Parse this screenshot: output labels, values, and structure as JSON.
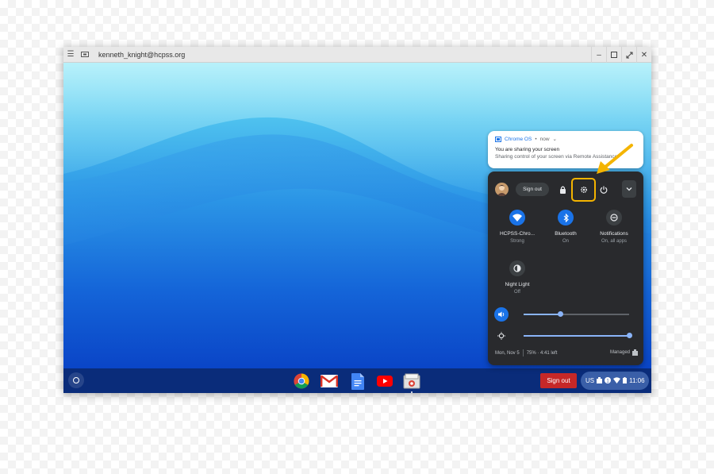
{
  "window": {
    "title": "kenneth_knight@hcpss.org",
    "controls": [
      "minimize",
      "maximize",
      "fullscreen",
      "close"
    ]
  },
  "notification": {
    "source": "Chrome OS",
    "time": "now",
    "title": "You are sharing your screen",
    "body": "Sharing control of your screen via Remote Assistance"
  },
  "quick_settings": {
    "sign_out_label": "Sign out",
    "features": [
      {
        "label": "HCPSS-Chro...",
        "sub": "Strong",
        "icon": "wifi-icon",
        "active": true
      },
      {
        "label": "Bluetooth",
        "sub": "On",
        "icon": "bluetooth-icon",
        "active": true
      },
      {
        "label": "Notifications",
        "sub": "On, all apps",
        "icon": "notifications-icon",
        "active": false
      },
      {
        "label": "Night Light",
        "sub": "Off",
        "icon": "night-light-icon",
        "active": false
      }
    ],
    "volume_level": 0.35,
    "brightness_level": 1.0,
    "date": "Mon, Nov 5",
    "battery": "75% · 4:41 left",
    "managed_label": "Managed"
  },
  "shelf": {
    "apps": [
      "chrome-icon",
      "gmail-icon",
      "docs-icon",
      "youtube-icon",
      "files-icon"
    ],
    "sign_out_label": "Sign out",
    "tray": {
      "locale": "US",
      "time": "11:06"
    }
  },
  "colors": {
    "accent": "#8ab4f8",
    "highlight": "#f4b400",
    "active_toggle": "#1a73e8",
    "sign_out_red": "#c62828"
  }
}
